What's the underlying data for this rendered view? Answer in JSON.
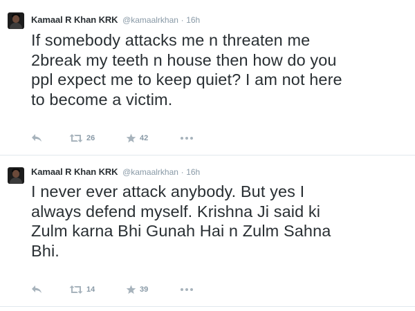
{
  "tweets": [
    {
      "author_name": "Kamaal R Khan KRK",
      "handle": "@kamaalrkhan",
      "separator": "·",
      "time": "16h",
      "text_lines": [
        "If somebody attacks me n threaten me",
        "2break my teeth n house then how do you",
        "ppl expect me to keep quiet? I am not here",
        "to become a victim."
      ],
      "retweets": "26",
      "favorites": "42"
    },
    {
      "author_name": "Kamaal R Khan KRK",
      "handle": "@kamaalrkhan",
      "separator": "·",
      "time": "16h",
      "text_lines": [
        "I never ever attack anybody. But yes I",
        "always defend myself. Krishna Ji said ki",
        "Zulm karna Bhi Gunah Hai n Zulm Sahna",
        "Bhi."
      ],
      "retweets": "14",
      "favorites": "39"
    }
  ],
  "icons": {
    "reply": "reply-icon",
    "retweet": "retweet-icon",
    "favorite": "star-icon",
    "more": "more-dots-icon"
  },
  "colors": {
    "text": "#292f33",
    "muted": "#8899a6",
    "icon": "#a7b3bc",
    "divider": "#e1e8ed"
  }
}
